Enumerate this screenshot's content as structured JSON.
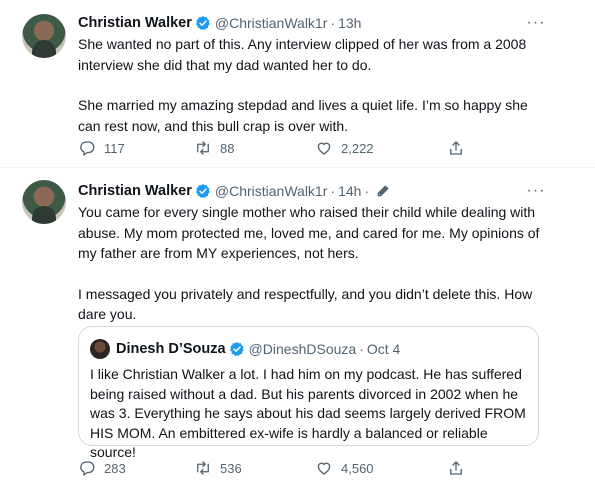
{
  "colors": {
    "text": "#0f1419",
    "secondary": "#536471",
    "verified": "#1d9bf0",
    "border": "#cfd9de"
  },
  "tweets": [
    {
      "author": {
        "name": "Christian Walker",
        "handle": "@ChristianWalk1r",
        "verified": true
      },
      "separator": "·",
      "time": "13h",
      "edited": false,
      "paragraphs": [
        "She wanted no part of this. Any interview clipped of her was from a 2008 interview she did that my dad wanted her to do.",
        "She married my amazing stepdad and lives a quiet life. I’m so happy she can rest now, and this bull crap is over with."
      ],
      "stats": {
        "replies": "117",
        "retweets": "88",
        "likes": "2,222"
      },
      "icons": {
        "reply": "reply-icon",
        "retweet": "retweet-icon",
        "like": "heart-icon",
        "share": "share-icon",
        "more": "more-icon"
      }
    },
    {
      "author": {
        "name": "Christian Walker",
        "handle": "@ChristianWalk1r",
        "verified": true
      },
      "separator": "·",
      "time": "14h",
      "time_suffix": "·",
      "edited": true,
      "paragraphs": [
        "You came for every single mother who raised their child while dealing with abuse. My mom protected me, loved me, and cared for me. My opinions of my father are from MY experiences, not hers.",
        "I messaged you privately and respectfully, and you didn’t delete this. How dare you."
      ],
      "quote": {
        "author": {
          "name": "Dinesh D’Souza",
          "handle": "@DineshDSouza",
          "verified": true
        },
        "separator": "·",
        "time": "Oct 4",
        "text": "I like Christian Walker a lot. I had him on my podcast. He has suffered being raised without a dad. But his parents divorced in 2002 when he was 3. Everything he says about his dad seems largely derived FROM HIS MOM. An embittered ex-wife is hardly a balanced or reliable source!"
      },
      "stats": {
        "replies": "283",
        "retweets": "536",
        "likes": "4,560"
      },
      "icons": {
        "reply": "reply-icon",
        "retweet": "retweet-icon",
        "like": "heart-icon",
        "share": "share-icon",
        "more": "more-icon",
        "edit": "edit-pencil-icon"
      }
    }
  ]
}
